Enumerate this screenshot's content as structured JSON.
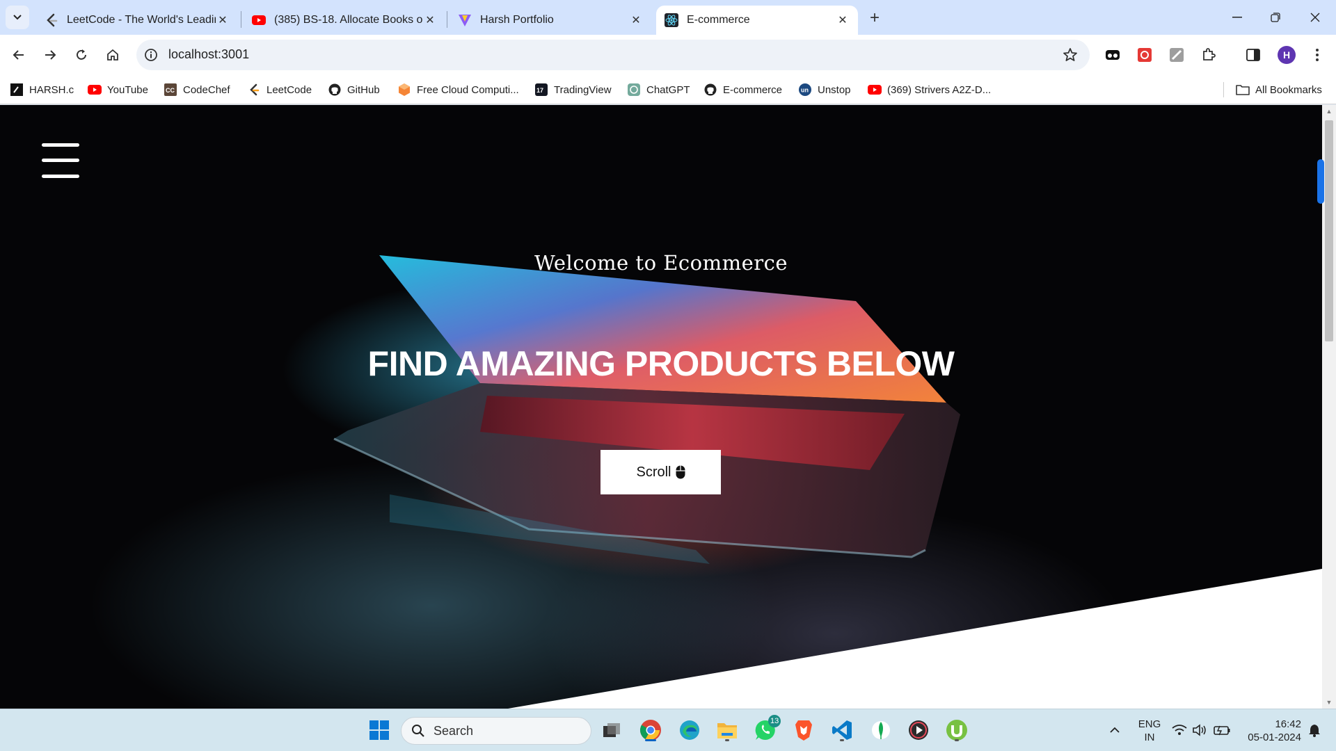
{
  "browser": {
    "tabs": [
      {
        "title": "LeetCode - The World's Leading",
        "icon": "leetcode-icon"
      },
      {
        "title": "(385) BS-18. Allocate Books or B",
        "icon": "youtube-icon"
      },
      {
        "title": "Harsh Portfolio",
        "icon": "vite-icon"
      },
      {
        "title": "E-commerce",
        "icon": "react-icon"
      }
    ],
    "url": "localhost:3001",
    "profile_initial": "H",
    "bookmarks": [
      {
        "label": "HARSH.c",
        "icon": "harsh-icon"
      },
      {
        "label": "YouTube",
        "icon": "youtube-icon"
      },
      {
        "label": "CodeChef",
        "icon": "codechef-icon"
      },
      {
        "label": "LeetCode",
        "icon": "leetcode-icon"
      },
      {
        "label": "GitHub",
        "icon": "github-icon"
      },
      {
        "label": "Free Cloud Computi...",
        "icon": "aws-icon"
      },
      {
        "label": "TradingView",
        "icon": "tradingview-icon"
      },
      {
        "label": "ChatGPT",
        "icon": "chatgpt-icon"
      },
      {
        "label": "E-commerce",
        "icon": "github-icon"
      },
      {
        "label": "Unstop",
        "icon": "unstop-icon"
      },
      {
        "label": "(369) Strivers A2Z-D...",
        "icon": "youtube-icon"
      }
    ],
    "all_bookmarks": "All Bookmarks"
  },
  "hero": {
    "welcome": "Welcome to Ecommerce",
    "headline": "FIND AMAZING PRODUCTS BELOW",
    "scroll_label": "Scroll"
  },
  "taskbar": {
    "search_placeholder": "Search",
    "whatsapp_badge": "13",
    "language": "ENG",
    "region": "IN",
    "time": "16:42",
    "date": "05-01-2024"
  },
  "colors": {
    "tabstrip": "#d3e3fd",
    "accent": "#1a73e8",
    "hero_bg": "#050507",
    "taskbar": "#d3e6ef"
  }
}
